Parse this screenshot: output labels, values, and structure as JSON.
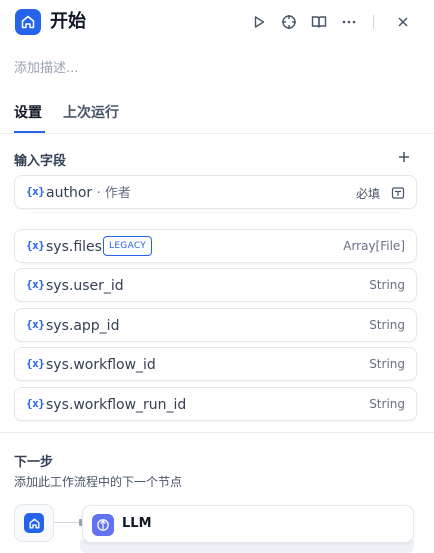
{
  "header": {
    "title": "开始",
    "icons": [
      "home-icon",
      "play-icon",
      "crosshair-icon",
      "book-icon",
      "more-icon",
      "close-icon"
    ]
  },
  "description_placeholder": "添加描述...",
  "tabs": [
    {
      "label": "设置",
      "active": true
    },
    {
      "label": "上次运行",
      "active": false
    }
  ],
  "input_section": {
    "title": "输入字段",
    "user_fields": [
      {
        "name": "author",
        "label": "· 作者",
        "required": "必填"
      }
    ],
    "system_fields": [
      {
        "name": "sys.files",
        "badge": "LEGACY",
        "type": "Array[File]"
      },
      {
        "name": "sys.user_id",
        "type": "String"
      },
      {
        "name": "sys.app_id",
        "type": "String"
      },
      {
        "name": "sys.workflow_id",
        "type": "String"
      },
      {
        "name": "sys.workflow_run_id",
        "type": "String"
      }
    ],
    "var_symbol": "{x}"
  },
  "next_step": {
    "title": "下一步",
    "description": "添加此工作流程中的下一个节点",
    "next_node": "LLM"
  },
  "colors": {
    "accent": "#2563eb",
    "llm": "#6172f3"
  }
}
